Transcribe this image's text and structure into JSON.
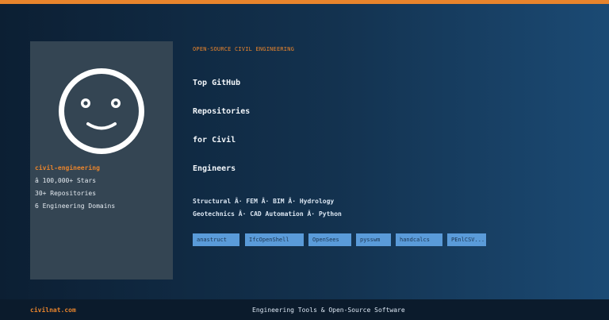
{
  "header": {
    "accent_color": "#e8842c"
  },
  "profile": {
    "avatar_icon": "smiley-face-icon",
    "handle": "civil-engineering",
    "stats": [
      "â­ 100,000+ Stars",
      "30+ Repositories",
      "6 Engineering Domains"
    ]
  },
  "hero": {
    "kicker": "OPEN-SOURCE CIVIL ENGINEERING",
    "title_lines": [
      "Top GitHub",
      "Repositories",
      "for Civil",
      "Engineers"
    ],
    "tag_lines": [
      "Structural Â· FEM Â· BIM Â· Hydrology",
      "Geotechnics Â· CAD Automation Â· Python"
    ],
    "repos": [
      "anastruct",
      "IfcOpenShell",
      "OpenSees",
      "pysswm",
      "handcalcs",
      "PEnlCSV..."
    ]
  },
  "footer": {
    "site": "civilnat.com",
    "tagline": "Engineering Tools & Open-Source Software"
  }
}
